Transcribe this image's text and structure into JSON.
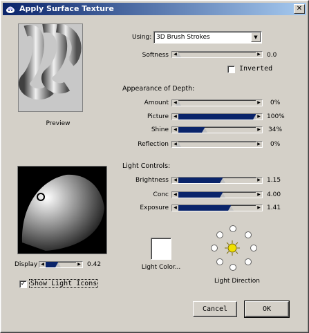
{
  "window": {
    "title": "Apply Surface Texture",
    "close_label": "✕"
  },
  "preview": {
    "caption": "Preview"
  },
  "texture": {
    "using_label": "Using:",
    "using_value": "3D Brush Strokes"
  },
  "softness": {
    "label": "Softness",
    "value": "0.0",
    "level": 0.0
  },
  "inverted": {
    "label": "Inverted",
    "checked": false
  },
  "depth": {
    "heading": "Appearance of Depth:",
    "sliders": [
      {
        "label": "Amount",
        "value": "0%",
        "level": 0.0
      },
      {
        "label": "Picture",
        "value": "100%",
        "level": 1.0
      },
      {
        "label": "Shine",
        "value": "34%",
        "level": 0.34
      },
      {
        "label": "Reflection",
        "value": "0%",
        "level": 0.0
      }
    ]
  },
  "light": {
    "heading": "Light Controls:",
    "sliders": [
      {
        "label": "Brightness",
        "value": "1.15",
        "level": 0.57
      },
      {
        "label": "Conc",
        "value": "4.00",
        "level": 0.57
      },
      {
        "label": "Exposure",
        "value": "1.41",
        "level": 0.68
      }
    ],
    "color_label": "Light Color...",
    "direction_label": "Light Direction"
  },
  "display": {
    "label": "Display",
    "value": "0.42",
    "level": 0.42
  },
  "show_light_icons": {
    "label": "Show Light Icons",
    "checked": true,
    "check_glyph": "✓"
  },
  "buttons": {
    "cancel": "Cancel",
    "ok": "OK"
  },
  "colors": {
    "title_start": "#0a246a",
    "slider_fill": "#0a246a",
    "sun": "#f0e000"
  },
  "icons": {
    "app": "paint-app-icon",
    "close": "close-icon",
    "dropdown": "chevron-down-icon",
    "sun": "sun-icon"
  }
}
